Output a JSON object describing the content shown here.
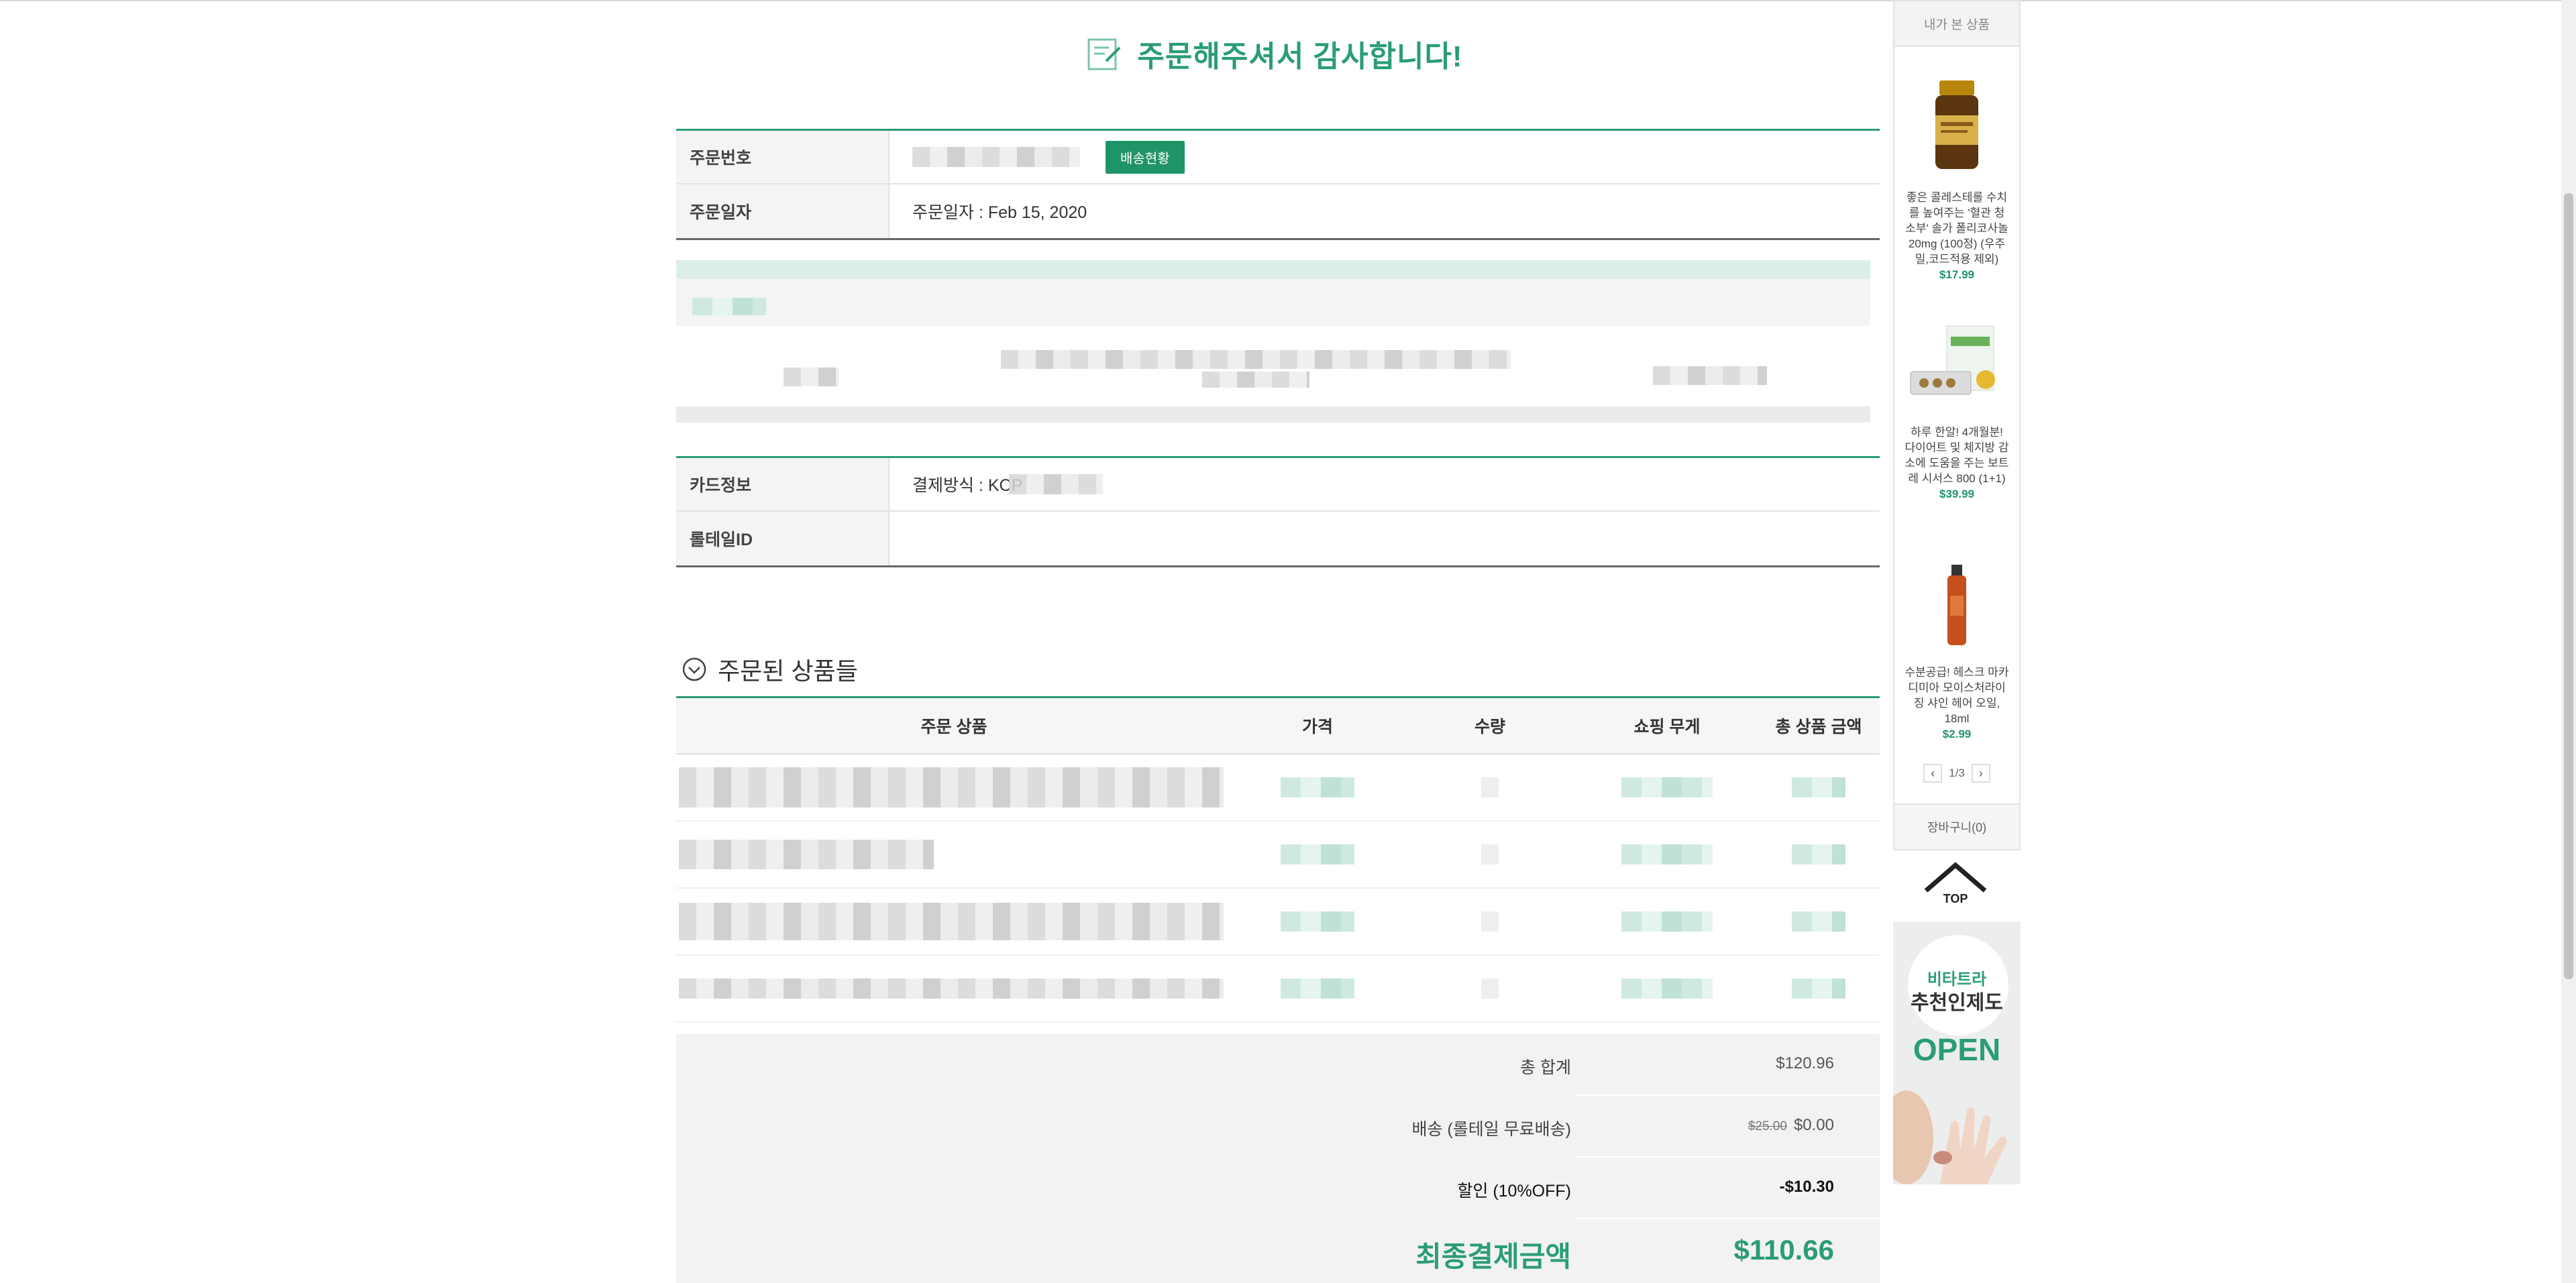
{
  "header": {
    "title": "주문해주셔서 감사합니다!"
  },
  "order_info": {
    "order_no_label": "주문번호",
    "delivery_status_button": "배송현황",
    "order_date_label": "주문일자",
    "order_date_value": "주문일자 : Feb 15, 2020"
  },
  "payment_info": {
    "card_label": "카드정보",
    "payment_method_value": "결제방식 : KCP",
    "rolltail_id_label": "롤테일ID"
  },
  "products": {
    "section_title": "주문된 상품들",
    "headers": [
      "주문 상품",
      "가격",
      "수량",
      "쇼핑 무게",
      "총 상품 금액"
    ]
  },
  "totals": {
    "subtotal_label": "총 합계",
    "subtotal_value": "$120.96",
    "shipping_label": "배송 (롤테일 무료배송)",
    "shipping_original": "$25.00",
    "shipping_value": "$0.00",
    "discount_label": "할인 (10%OFF)",
    "discount_value": "-$10.30",
    "final_label": "최종결제금액",
    "final_value": "$110.66"
  },
  "sidebar": {
    "recent_title": "내가 본 상품",
    "items": [
      {
        "name": "좋은 콜레스테롤 수치를 높여주는 '혈관 청소부' 솔가 폴리코사놀 20mg (100정) (우주밀,코드적용 제외)",
        "price": "$17.99"
      },
      {
        "name": "하루 한알! 4개월분! 다이어트 및 체지방 감소에 도움을 주는 보트레 시서스 800 (1+1)",
        "price": "$39.99"
      },
      {
        "name": "수분공급! 헤스크 마카디미아 모이스처라이징 샤인 헤어 오일, 18ml",
        "price": "$2.99"
      }
    ],
    "pager": "1/3",
    "cart_label": "장바구니(0)",
    "top_label": "TOP",
    "banner": {
      "line1": "비타트라",
      "line2": "추천인제도",
      "line3": "OPEN"
    }
  },
  "colors": {
    "accent": "#2a9d74",
    "button": "#1f9467"
  }
}
